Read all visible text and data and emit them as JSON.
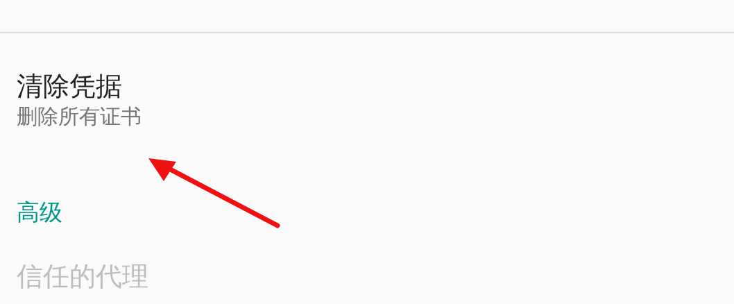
{
  "preferences": [
    {
      "kind": "preference",
      "title": "清除凭据",
      "summary": "删除所有证书",
      "disabled": false
    },
    {
      "kind": "category",
      "title": "高级"
    },
    {
      "kind": "preference",
      "title": "信任的代理",
      "disabled": true
    }
  ]
}
